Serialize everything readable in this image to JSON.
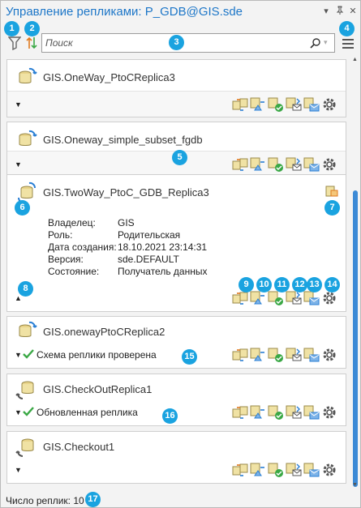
{
  "window": {
    "title": "Управление репликами: P_GDB@GIS.sde"
  },
  "toolbar": {
    "search_placeholder": "Поиск"
  },
  "callouts": [
    "1",
    "2",
    "3",
    "4",
    "5",
    "6",
    "7",
    "8",
    "9",
    "10",
    "11",
    "12",
    "13",
    "14",
    "15",
    "16",
    "17"
  ],
  "replicas": [
    {
      "name": "GIS.OneWay_PtoCReplica3",
      "status": ""
    },
    {
      "name": "GIS.Oneway_simple_subset_fgdb",
      "status": ""
    },
    {
      "name": "GIS.TwoWay_PtoC_GDB_Replica3",
      "status": "",
      "properties": [
        {
          "key": "Владелец:",
          "value": "GIS"
        },
        {
          "key": "Роль:",
          "value": "Родительская"
        },
        {
          "key": "Дата создания:",
          "value": "18.10.2021 23:14:31"
        },
        {
          "key": "Версия:",
          "value": "sde.DEFAULT"
        },
        {
          "key": "Состояние:",
          "value": "Получатель данных"
        }
      ]
    },
    {
      "name": "GIS.onewayPtoCReplica2",
      "status": "Схема реплики проверена"
    },
    {
      "name": "GIS.CheckOutReplica1",
      "status": "Обновленная реплика"
    },
    {
      "name": "GIS.Checkout1",
      "status": ""
    }
  ],
  "footer": {
    "count_label": "Число реплик: 10"
  },
  "colors": {
    "title": "#1e77c8",
    "badge": "#1aa3e0",
    "scroll_thumb": "#3c8ad6",
    "check": "#3aa845"
  }
}
